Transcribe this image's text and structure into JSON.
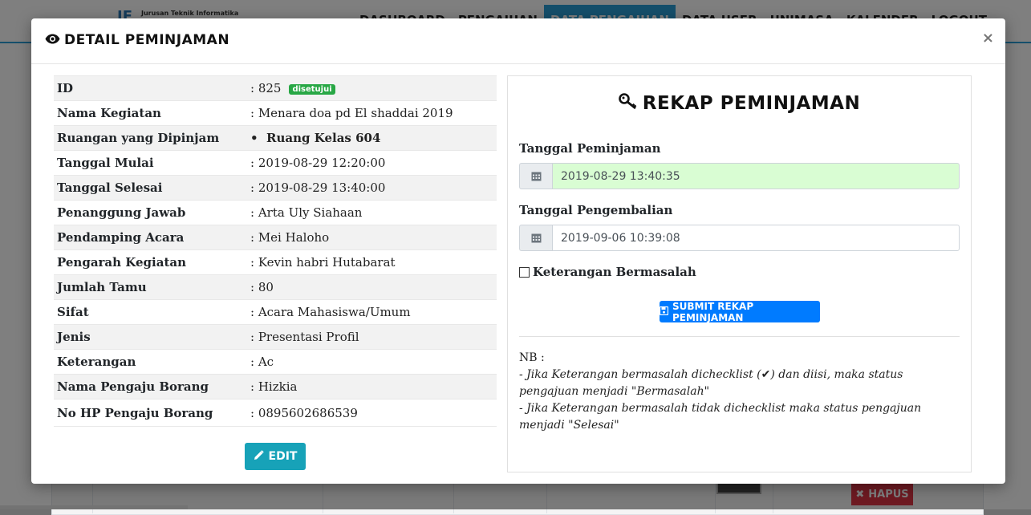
{
  "background": {
    "logo_mark": "IF",
    "logo_text": "Jurusan Teknik Informatika",
    "nav": [
      "DASHBOARD",
      "PENGAJUAN",
      "DATA PENGAJUAN",
      "DATA USER",
      "UNIMASA",
      "KALENDER",
      "LOGOUT"
    ],
    "nav_active": "DATA PENGAJUAN",
    "hapus_label": "HAPUS"
  },
  "modal": {
    "title": "DETAIL PEMINJAMAN",
    "close": "×"
  },
  "detail": {
    "rows": [
      {
        "label": "ID",
        "value": ": 825",
        "badge": "disetujui"
      },
      {
        "label": "Nama Kegiatan",
        "value": ": Menara doa pd El shaddai 2019"
      },
      {
        "label": "Ruangan yang Dipinjam",
        "value": "Ruang Kelas 604"
      },
      {
        "label": "Tanggal Mulai",
        "value": ": 2019-08-29 12:20:00"
      },
      {
        "label": "Tanggal Selesai",
        "value": ": 2019-08-29 13:40:00"
      },
      {
        "label": "Penanggung Jawab",
        "value": ": Arta Uly Siahaan"
      },
      {
        "label": "Pendamping Acara",
        "value": ": Mei Haloho"
      },
      {
        "label": "Pengarah Kegiatan",
        "value": ": Kevin habri Hutabarat"
      },
      {
        "label": "Jumlah Tamu",
        "value": ": 80"
      },
      {
        "label": "Sifat",
        "value": ": Acara Mahasiswa/Umum"
      },
      {
        "label": "Jenis",
        "value": ": Presentasi Profil"
      },
      {
        "label": "Keterangan",
        "value": ": Ac"
      },
      {
        "label": "Nama Pengaju Borang",
        "value": ": Hizkia"
      },
      {
        "label": "No HP Pengaju Borang",
        "value": ": 0895602686539"
      }
    ],
    "edit_label": "EDIT"
  },
  "rekap": {
    "title": "REKAP PEMINJAMAN",
    "tanggal_peminjaman_label": "Tanggal Peminjaman",
    "tanggal_peminjaman_value": "2019-08-29 13:40:35",
    "tanggal_pengembalian_label": "Tanggal Pengembalian",
    "tanggal_pengembalian_value": "2019-09-06 10:39:08",
    "checkbox_label": "Keterangan Bermasalah",
    "submit_label": "SUBMIT REKAP PEMINJAMAN",
    "nb_title": "NB :",
    "nb_line1_a": "- Jika Keterangan bermasalah dichecklist (",
    "nb_line1_b": ") dan diisi, maka status pengajuan menjadi \"Bermasalah\"",
    "nb_line2": "- Jika Keterangan bermasalah tidak dichecklist maka status pengajuan menjadi \"Selesai\""
  },
  "colors": {
    "primary": "#007bff",
    "info": "#17a2b8",
    "success": "#28a745",
    "danger": "#dc3545",
    "valid_input_bg": "#d9fdd3"
  }
}
